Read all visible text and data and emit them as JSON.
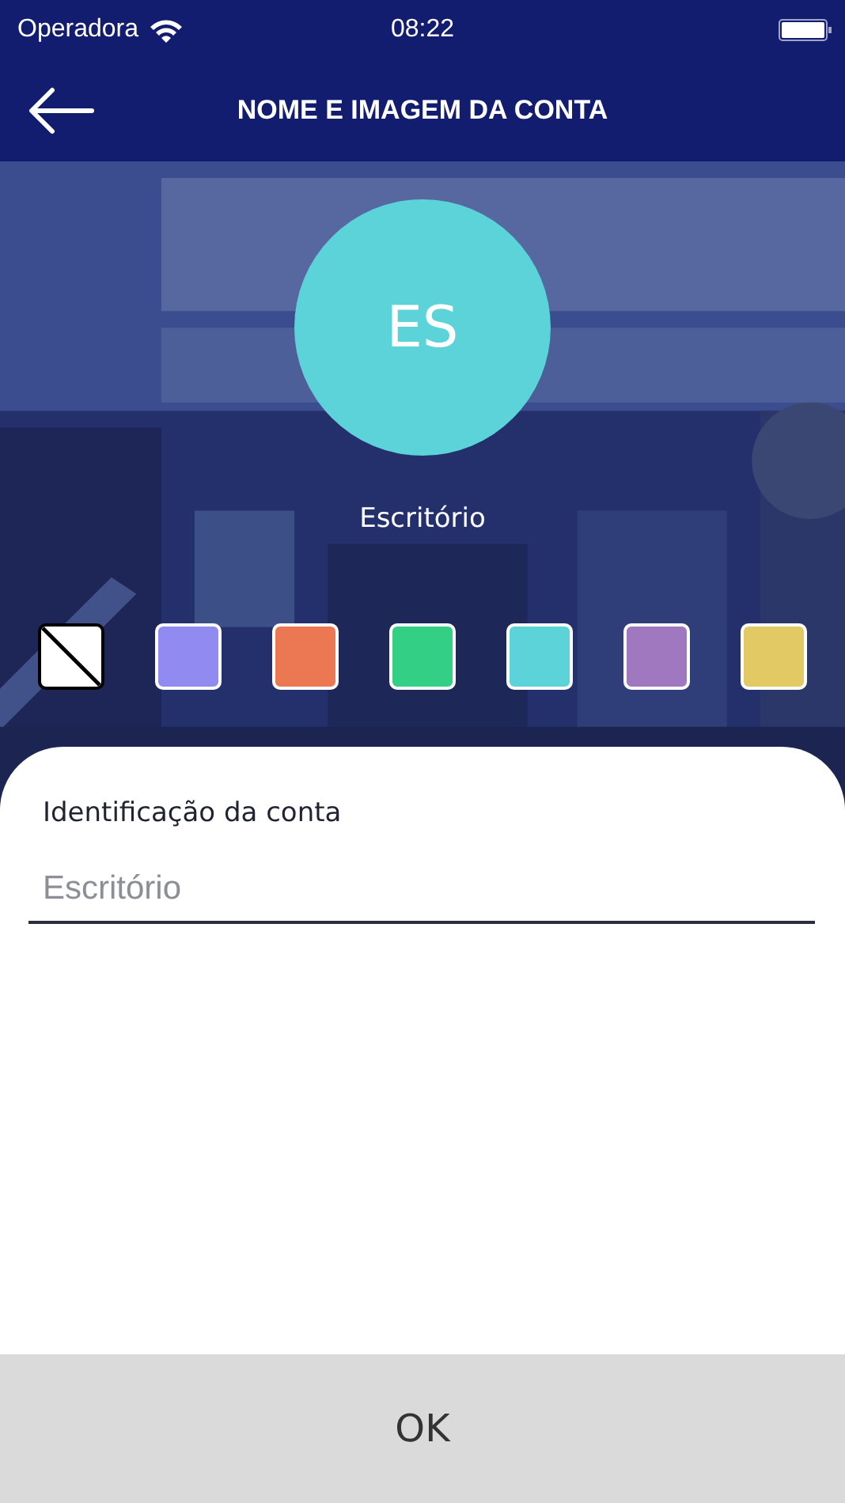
{
  "status_bar": {
    "carrier": "Operadora",
    "time": "08:22"
  },
  "header": {
    "title": "NOME E IMAGEM DA CONTA"
  },
  "avatar": {
    "initials": "ES",
    "color": "#5bd3d8",
    "name": "Escritório"
  },
  "swatches": [
    {
      "kind": "none"
    },
    {
      "kind": "color",
      "color": "#918bf1"
    },
    {
      "kind": "color",
      "color": "#ec7753"
    },
    {
      "kind": "color",
      "color": "#33cf85"
    },
    {
      "kind": "color",
      "color": "#5bd3d8"
    },
    {
      "kind": "color",
      "color": "#a078c0"
    },
    {
      "kind": "color",
      "color": "#e2c964"
    }
  ],
  "form": {
    "label": "Identificação da conta",
    "placeholder": "Escritório"
  },
  "ok_button": "OK"
}
